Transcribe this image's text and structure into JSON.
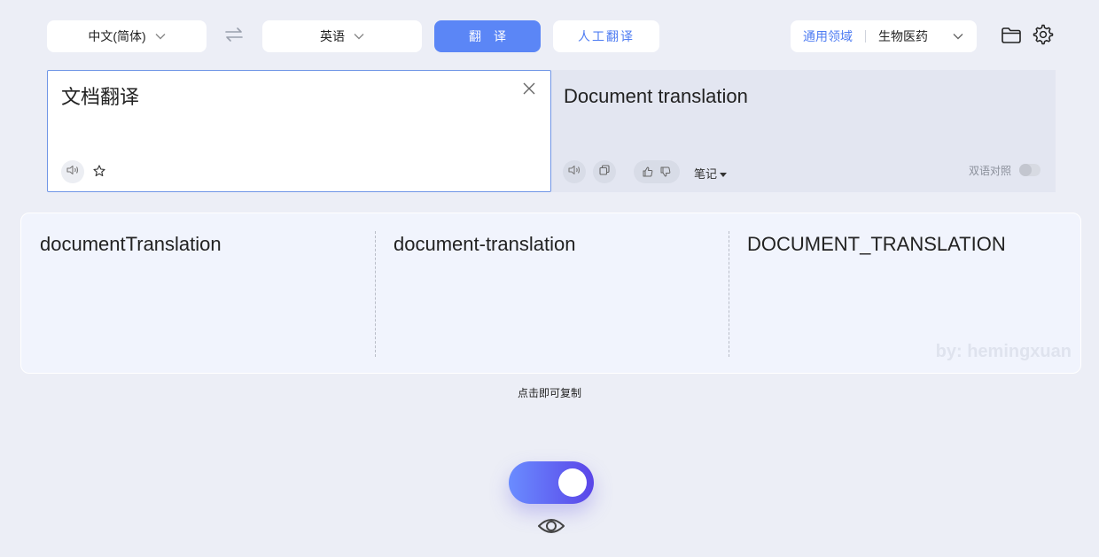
{
  "toolbar": {
    "source_lang": "中文(简体)",
    "target_lang": "英语",
    "translate_label": "翻译",
    "human_translate_label": "人工翻译",
    "domain_general": "通用领域",
    "domain_selected": "生物医药"
  },
  "source": {
    "text": "文档翻译"
  },
  "target": {
    "text": "Document translation",
    "notes_label": "笔记",
    "bilingual_label": "双语对照"
  },
  "case_variants": [
    "documentTranslation",
    "document-translation",
    "DOCUMENT_TRANSLATION"
  ],
  "watermark": "by: hemingxuan",
  "copy_hint": "点击即可复制",
  "colors": {
    "accent": "#5b86f6",
    "link": "#4e7cf2",
    "background": "#eceef6"
  },
  "icons": {
    "chevron": "chevron-down-icon",
    "swap": "swap-icon",
    "folder": "folder-icon",
    "settings": "gear-icon",
    "clear": "close-icon",
    "speaker": "speaker-icon",
    "star": "star-icon",
    "copy": "copy-icon",
    "like": "thumbs-up-icon",
    "dislike": "thumbs-down-icon",
    "eye": "eye-icon"
  }
}
